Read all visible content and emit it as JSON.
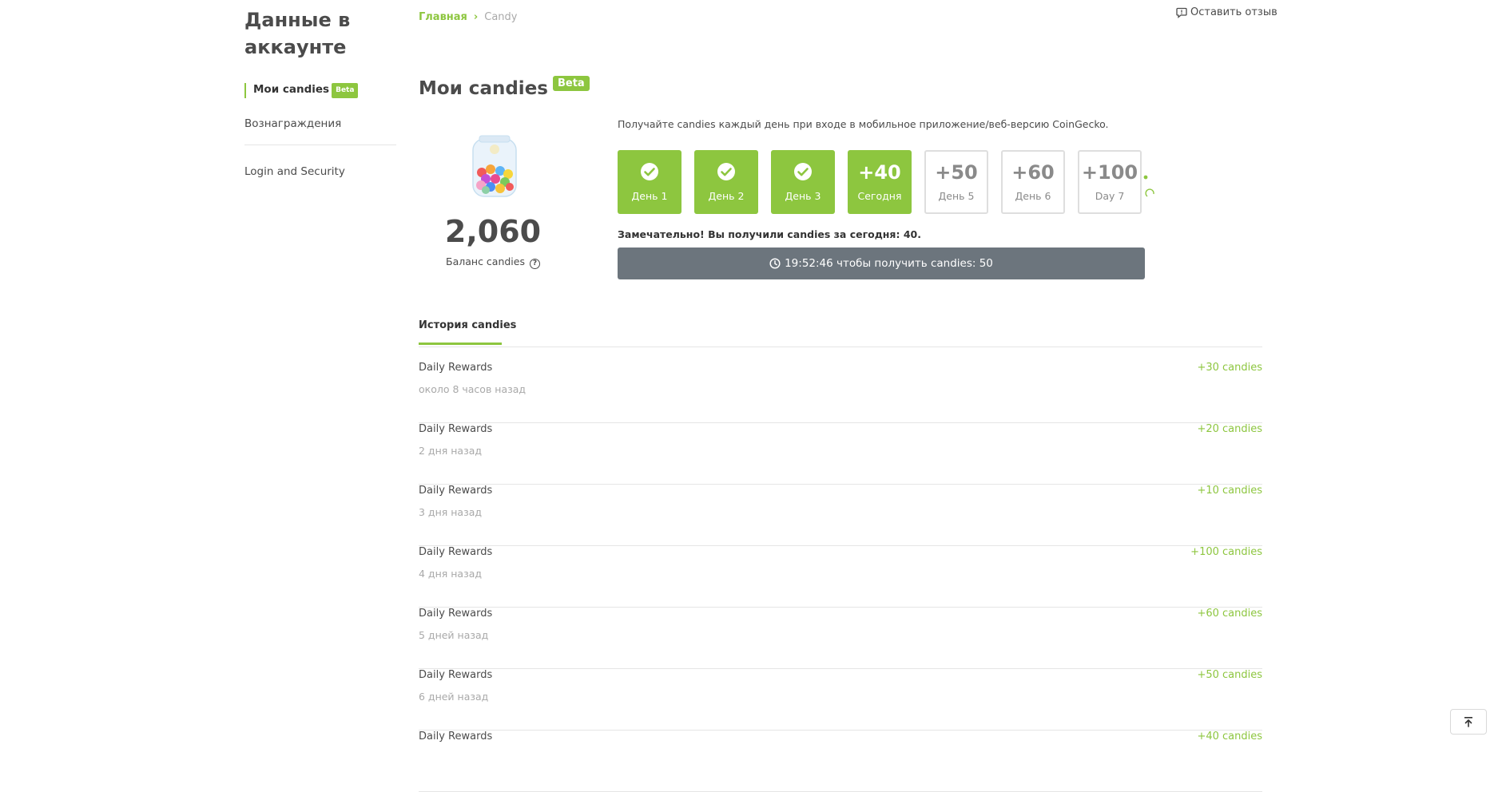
{
  "sidebar": {
    "title": "Данные в аккаунте",
    "items": [
      {
        "label": "Мои candies",
        "badge": "Beta",
        "active": true
      },
      {
        "label": "Вознаграждения",
        "active": false
      },
      {
        "label": "Login and Security",
        "active": false
      }
    ]
  },
  "breadcrumb": {
    "home": "Главная",
    "current": "Candy"
  },
  "feedback_label": "Оставить отзыв",
  "page": {
    "title": "Мои candies",
    "badge": "Beta"
  },
  "balance": {
    "value": "2,060",
    "label": "Баланс candies"
  },
  "intro_text": "Получайте candies каждый день при входе в мобильное приложение/веб-версию CoinGecko.",
  "days": [
    {
      "label": "День 1",
      "state": "done"
    },
    {
      "label": "День 2",
      "state": "done"
    },
    {
      "label": "День 3",
      "state": "done"
    },
    {
      "amount": "+40",
      "label": "Сегодня",
      "state": "today"
    },
    {
      "amount": "+50",
      "label": "День 5",
      "state": "future"
    },
    {
      "amount": "+60",
      "label": "День 6",
      "state": "future"
    },
    {
      "amount": "+100",
      "label": "Day 7",
      "state": "future"
    }
  ],
  "success_message": "Замечательно! Вы получили candies за сегодня: 40.",
  "countdown_label": "19:52:46 чтобы получить candies: 50",
  "history": {
    "tab_label": "История candies",
    "rows": [
      {
        "title": "Daily Rewards",
        "time": "около 8 часов назад",
        "amount": "+30 candies"
      },
      {
        "title": "Daily Rewards",
        "time": "2 дня назад",
        "amount": "+20 candies"
      },
      {
        "title": "Daily Rewards",
        "time": "3 дня назад",
        "amount": "+10 candies"
      },
      {
        "title": "Daily Rewards",
        "time": "4 дня назад",
        "amount": "+100 candies"
      },
      {
        "title": "Daily Rewards",
        "time": "5 дней назад",
        "amount": "+60 candies"
      },
      {
        "title": "Daily Rewards",
        "time": "6 дней назад",
        "amount": "+50 candies"
      },
      {
        "title": "Daily Rewards",
        "time": "",
        "amount": "+40 candies"
      }
    ]
  },
  "colors": {
    "accent": "#8dc63f",
    "button_gray": "#6c757d",
    "text": "#4b4b4b",
    "muted": "#a9a9a9"
  }
}
